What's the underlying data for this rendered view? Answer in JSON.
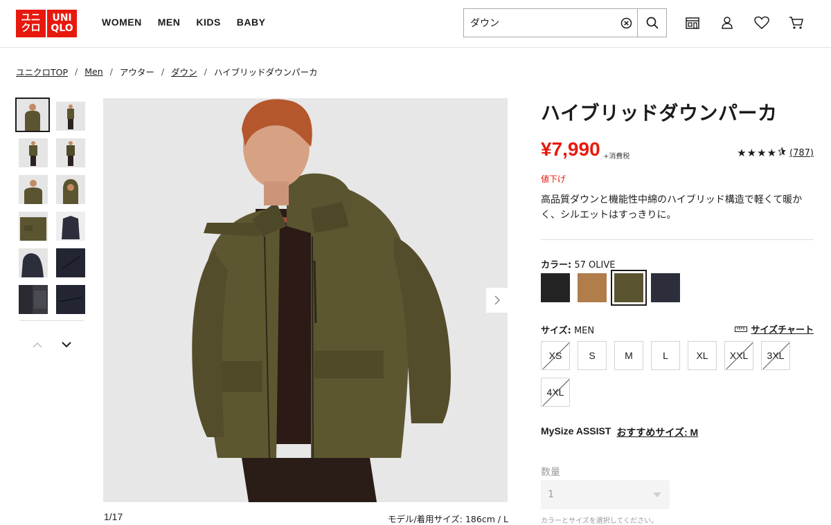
{
  "header": {
    "logo": {
      "line1": "ユニ",
      "line2": "クロ",
      "line3": "UNI",
      "line4": "QLO"
    },
    "nav": [
      "WOMEN",
      "MEN",
      "KIDS",
      "BABY"
    ],
    "search": {
      "value": "ダウン",
      "placeholder": ""
    },
    "icons": [
      "store-icon",
      "user-icon",
      "heart-icon",
      "cart-icon"
    ]
  },
  "breadcrumb": {
    "items": [
      "ユニクロTOP",
      "Men",
      "アウター",
      "ダウン",
      "ハイブリッドダウンパーカ"
    ],
    "separator": "/"
  },
  "gallery": {
    "counter": "1/17",
    "model_info": "モデル/着用サイズ: 186cm / L"
  },
  "product": {
    "title": "ハイブリッドダウンパーカ",
    "price": "¥7,990",
    "tax": "+消費税",
    "rating": {
      "stars": 4.5,
      "count": "(787)"
    },
    "sale_tag": "値下げ",
    "description": "高品質ダウンと機能性中綿のハイブリッド構造で軽くて暖かく、シルエットはすっきりに。",
    "color": {
      "label": "カラー:",
      "selected": "57 OLIVE",
      "swatches": [
        {
          "name": "black",
          "hex": "#232323"
        },
        {
          "name": "brown",
          "hex": "#b07d4b"
        },
        {
          "name": "olive",
          "hex": "#5a5530"
        },
        {
          "name": "navy",
          "hex": "#2c2f3b"
        }
      ],
      "selected_index": 2
    },
    "size": {
      "label": "サイズ:",
      "category": "MEN",
      "chart_link": "サイズチャート",
      "options": [
        {
          "label": "XS",
          "available": false
        },
        {
          "label": "S",
          "available": true
        },
        {
          "label": "M",
          "available": true
        },
        {
          "label": "L",
          "available": true
        },
        {
          "label": "XL",
          "available": true
        },
        {
          "label": "XXL",
          "available": false
        },
        {
          "label": "3XL",
          "available": false
        },
        {
          "label": "4XL",
          "available": false
        }
      ]
    },
    "mysize": {
      "label": "MySize ASSIST",
      "recommend": "おすすめサイズ: M"
    },
    "quantity": {
      "label": "数量",
      "value": "1",
      "hint": "カラーとサイズを選択してください。"
    }
  },
  "colors": {
    "accent": "#e7190e",
    "text": "#1b1b1b"
  }
}
